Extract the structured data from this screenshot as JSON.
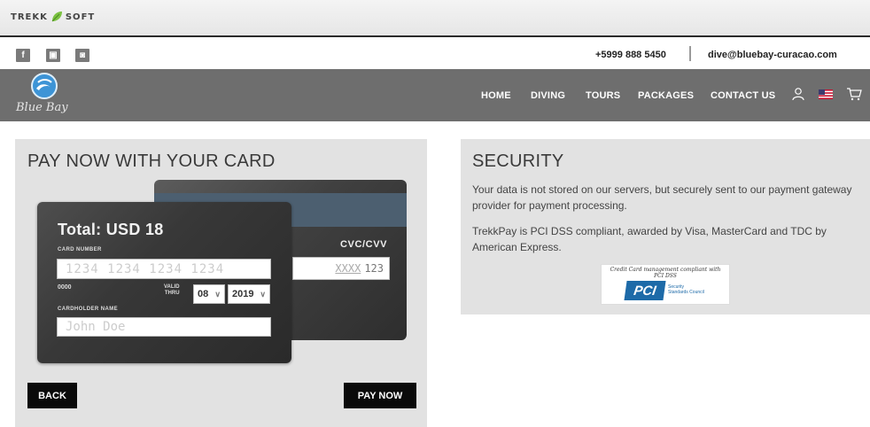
{
  "trekksoft": {
    "brand_left": "TREKK",
    "brand_right": "SOFT"
  },
  "contact": {
    "phone": "+5999 888 5450",
    "separator": "|",
    "email": "dive@bluebay-curacao.com"
  },
  "social": [
    {
      "name": "facebook",
      "glyph": "f"
    },
    {
      "name": "youtube",
      "glyph": "▣"
    },
    {
      "name": "instagram",
      "glyph": "◙"
    }
  ],
  "brand": {
    "logo_text": "Blue Bay"
  },
  "nav": {
    "items": [
      "HOME",
      "DIVING",
      "TOURS",
      "PACKAGES",
      "CONTACT US"
    ],
    "icons": [
      "user-icon",
      "us-flag-icon",
      "cart-icon"
    ]
  },
  "payment": {
    "title": "PAY NOW WITH YOUR CARD",
    "total": "Total: USD 18",
    "card_number_label": "CARD NUMBER",
    "card_number_placeholder": "1234 1234 1234 1234",
    "zeros": "0000",
    "valid_line1": "VALID",
    "valid_line2": "THRU",
    "month": "08",
    "year": "2019",
    "holder_label": "CARDHOLDER NAME",
    "holder_placeholder": "John Doe",
    "cvc_label": "CVC/CVV",
    "cvc_placeholder": "XXXX",
    "cvc_value": "123",
    "back_label": "BACK",
    "pay_label": "PAY NOW"
  },
  "security": {
    "title": "SECURITY",
    "paragraph1": "Your data is not stored on our servers, but securely sent to our payment gateway provider for payment processing.",
    "paragraph2": "TrekkPay is PCI DSS compliant, awarded by Visa, MasterCard and TDC by American Express.",
    "badge_caption": "Credit Card management compliant with PCI DSS",
    "badge_mark": "PCI",
    "badge_sub1": "Security",
    "badge_sub2": "Standards Council"
  },
  "colors": {
    "nav_bg": "#6e6e6e",
    "panel_bg": "#e2e2e2",
    "button_bg": "#0a0a0a",
    "logo_blue": "#3d94d6",
    "pci_blue": "#1d6aa8"
  }
}
